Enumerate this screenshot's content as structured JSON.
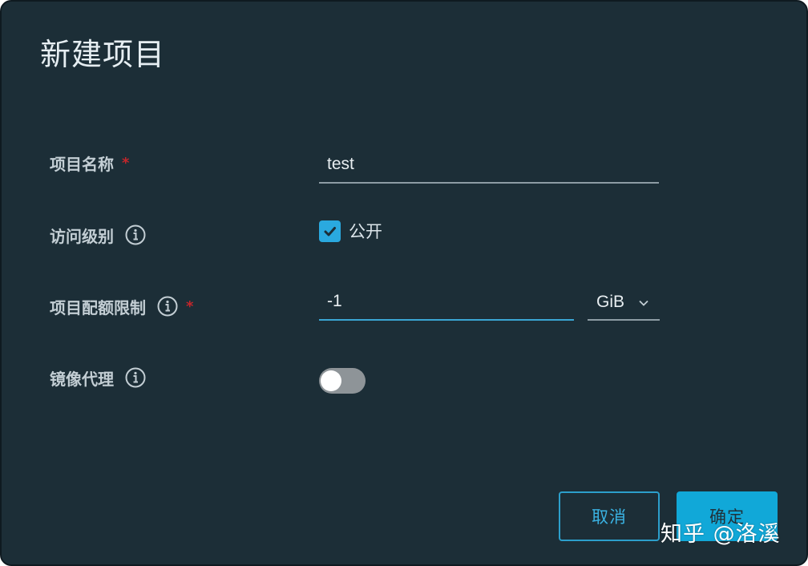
{
  "dialog": {
    "title": "新建项目",
    "colors": {
      "background": "#1c2e37",
      "accent": "#2aa9df",
      "primary_button": "#11a8d8",
      "required_mark": "#c3262b"
    }
  },
  "form": {
    "project_name": {
      "label": "项目名称",
      "required_mark": "*",
      "value": "test"
    },
    "access_level": {
      "label": "访问级别",
      "info_icon": "info-icon",
      "checkbox_label": "公开",
      "checked": true
    },
    "quota": {
      "label": "项目配额限制",
      "info_icon": "info-icon",
      "required_mark": "*",
      "value": "-1",
      "unit": "GiB"
    },
    "proxy_cache": {
      "label": "镜像代理",
      "info_icon": "info-icon",
      "enabled": false
    }
  },
  "actions": {
    "cancel_label": "取消",
    "ok_label": "确定"
  },
  "watermark": "知乎 @洛溪"
}
